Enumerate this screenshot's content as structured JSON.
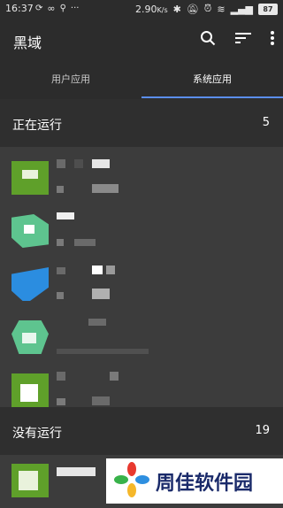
{
  "status_bar": {
    "time": "16:37",
    "speed": "2.90",
    "speed_unit": "K/s",
    "battery": "87"
  },
  "app_bar": {
    "title": "黑域",
    "search_icon": "search-icon",
    "sort_icon": "sort-icon",
    "more_icon": "more-vert-icon"
  },
  "tabs": [
    {
      "label": "用户应用",
      "active": false
    },
    {
      "label": "系统应用",
      "active": true
    }
  ],
  "running": {
    "title": "正在运行",
    "count": "5"
  },
  "not_running": {
    "title": "没有运行",
    "count": "19"
  },
  "watermark": {
    "text": "周佳软件园"
  },
  "colors": {
    "accent": "#5b8ef0",
    "background": "#3c3c3c",
    "bar": "#2c2c2c",
    "icon_green": "#5fa02a",
    "icon_mint": "#5ec48f",
    "icon_blue": "#2b8de0"
  }
}
